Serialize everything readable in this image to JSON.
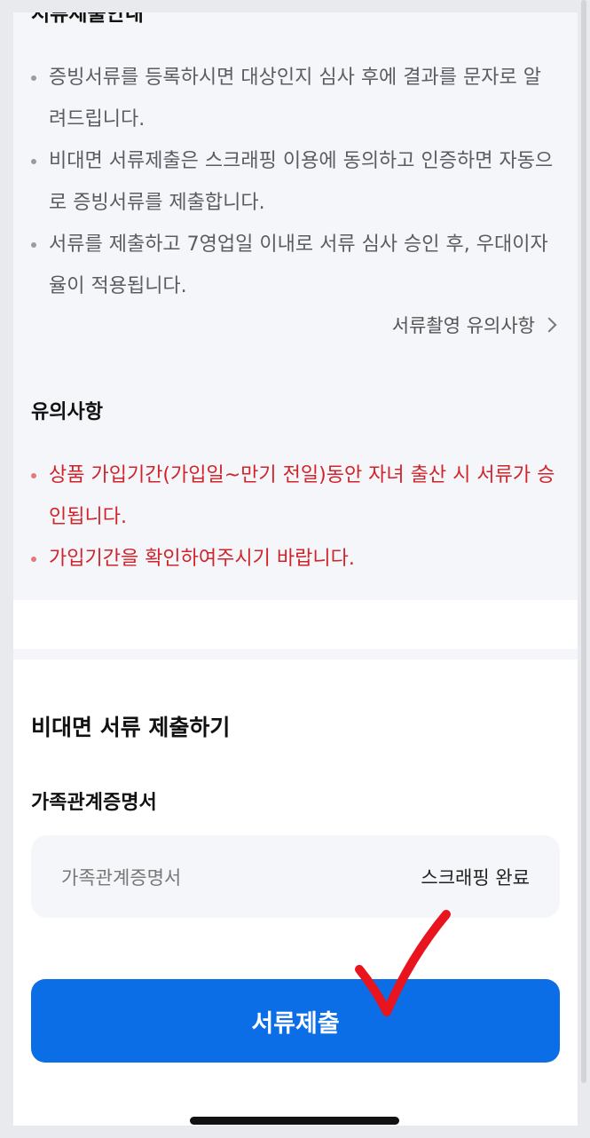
{
  "guide": {
    "title": "서류제출안내",
    "items": [
      "증빙서류를 등록하시면 대상인지 심사 후에 결과를 문자로 알려드립니다.",
      "비대면 서류제출은 스크래핑 이용에 동의하고 인증하면 자동으로 증빙서류를 제출합니다.",
      "서류를 제출하고 7영업일 이내로 서류 심사 승인 후, 우대이자율이 적용됩니다."
    ],
    "link_label": "서류촬영 유의사항"
  },
  "caution": {
    "title": "유의사항",
    "items": [
      "상품 가입기간(가입일~만기 전일)동안 자녀 출산 시 서류가 승인됩니다.",
      "가입기간을 확인하여주시기 바랍니다."
    ]
  },
  "submission": {
    "title": "비대면 서류 제출하기",
    "document_label": "가족관계증명서",
    "document_name": "가족관계증명서",
    "document_status": "스크래핑 완료",
    "submit_label": "서류제출"
  },
  "colors": {
    "primary": "#0b6ee6",
    "caution_text": "#d0242b",
    "checkmark": "#e8141e"
  },
  "icons": {
    "link": "chevron-right-icon",
    "overlay": "checkmark-annotation-icon"
  }
}
